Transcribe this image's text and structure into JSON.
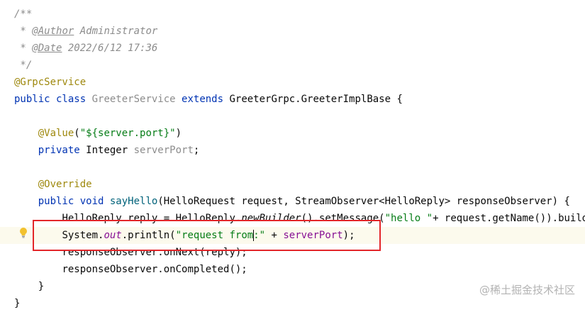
{
  "code": {
    "l1_comment_open": "/**",
    "l2_star": " * ",
    "l2_tag": "@Author",
    "l2_value": " Administrator",
    "l3_star": " * ",
    "l3_tag": "@Date",
    "l3_value": " 2022/6/12 17:36",
    "l4_comment_close": " */",
    "l5_annotation": "@GrpcService",
    "l6_public": "public",
    "l6_class": " class ",
    "l6_name": "GreeterService",
    "l6_extends": " extends ",
    "l6_base": "GreeterGrpc.GreeterImplBase {",
    "l8_annotation": "@Value",
    "l8_open": "(",
    "l8_string": "\"${server.port}\"",
    "l8_close": ")",
    "l9_private": "private",
    "l9_type": " Integer ",
    "l9_field": "serverPort",
    "l9_semi": ";",
    "l11_annotation": "@Override",
    "l12_public": "public",
    "l12_void": " void ",
    "l12_method": "sayHello",
    "l12_params": "(HelloRequest request, StreamObserver<HelloReply> responseObserver) {",
    "l13_a": "HelloReply reply = HelloReply.",
    "l13_newbuilder": "newBuilder",
    "l13_b": "().setMessage(",
    "l13_string": "\"hello \"",
    "l13_c": "+ request.getName()).build();",
    "l14_system": "System.",
    "l14_out": "out",
    "l14_println": ".println(",
    "l14_string_a": "\"request from",
    "l14_string_b": ":\"",
    "l14_plus": " + ",
    "l14_field": "serverPort",
    "l14_end": ");",
    "l15": "responseObserver.onNext(reply);",
    "l16": "responseObserver.onCompleted();",
    "l17": "}",
    "l18": "}"
  },
  "watermark": "@稀土掘金技术社区",
  "colors": {
    "highlight_box": "#e3262a",
    "keyword": "#0033b3",
    "annotation": "#9e880d",
    "string": "#067d17",
    "field": "#871094",
    "comment": "#8c8c8c"
  }
}
